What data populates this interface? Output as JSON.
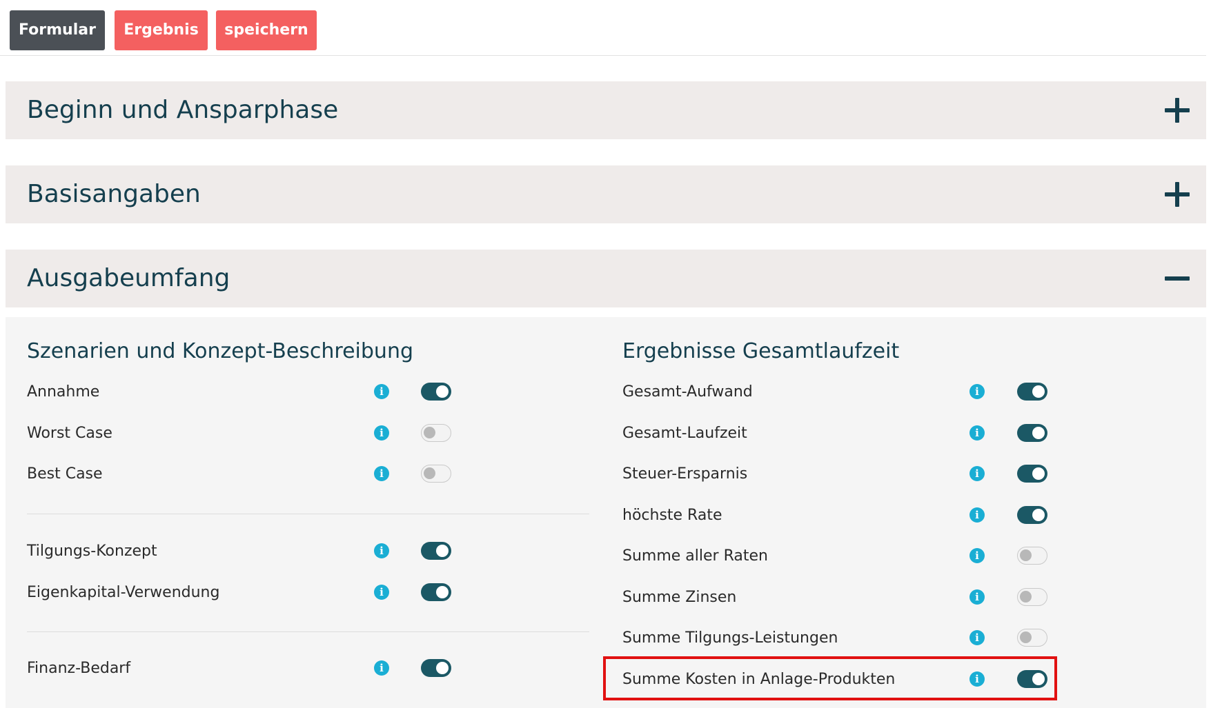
{
  "toolbar": {
    "formular": "Formular",
    "ergebnis": "Ergebnis",
    "speichern": "speichern"
  },
  "sections": [
    {
      "title": "Beginn und Ansparphase",
      "state": "collapsed",
      "icon": "plus-icon"
    },
    {
      "title": "Basisangaben",
      "state": "collapsed",
      "icon": "plus-icon"
    },
    {
      "title": "Ausgabeumfang",
      "state": "expanded",
      "icon": "minus-icon"
    }
  ],
  "left_column": {
    "title": "Szenarien und Konzept-Beschreibung",
    "groups": [
      [
        {
          "label": "Annahme",
          "enabled": true
        },
        {
          "label": "Worst Case",
          "enabled": false
        },
        {
          "label": "Best Case",
          "enabled": false
        }
      ],
      [
        {
          "label": "Tilgungs-Konzept",
          "enabled": true
        },
        {
          "label": "Eigenkapital-Verwendung",
          "enabled": true
        }
      ],
      [
        {
          "label": "Finanz-Bedarf",
          "enabled": true
        }
      ]
    ]
  },
  "right_column": {
    "title": "Ergebnisse Gesamtlaufzeit",
    "items": [
      {
        "label": "Gesamt-Aufwand",
        "enabled": true
      },
      {
        "label": "Gesamt-Laufzeit",
        "enabled": true
      },
      {
        "label": "Steuer-Ersparnis",
        "enabled": true
      },
      {
        "label": "höchste Rate",
        "enabled": true
      },
      {
        "label": "Summe aller Raten",
        "enabled": false
      },
      {
        "label": "Summe Zinsen",
        "enabled": false
      },
      {
        "label": "Summe Tilgungs-Leistungen",
        "enabled": false
      },
      {
        "label": "Summe Kosten in Anlage-Produkten",
        "enabled": true,
        "highlighted": true
      }
    ]
  },
  "info_glyph": "i",
  "colors": {
    "primary_dark": "#4b5056",
    "accent_red": "#f46060",
    "toggle_on": "#1b5865",
    "info": "#1aaed4",
    "heading": "#153f4e",
    "highlight": "#e11111"
  }
}
